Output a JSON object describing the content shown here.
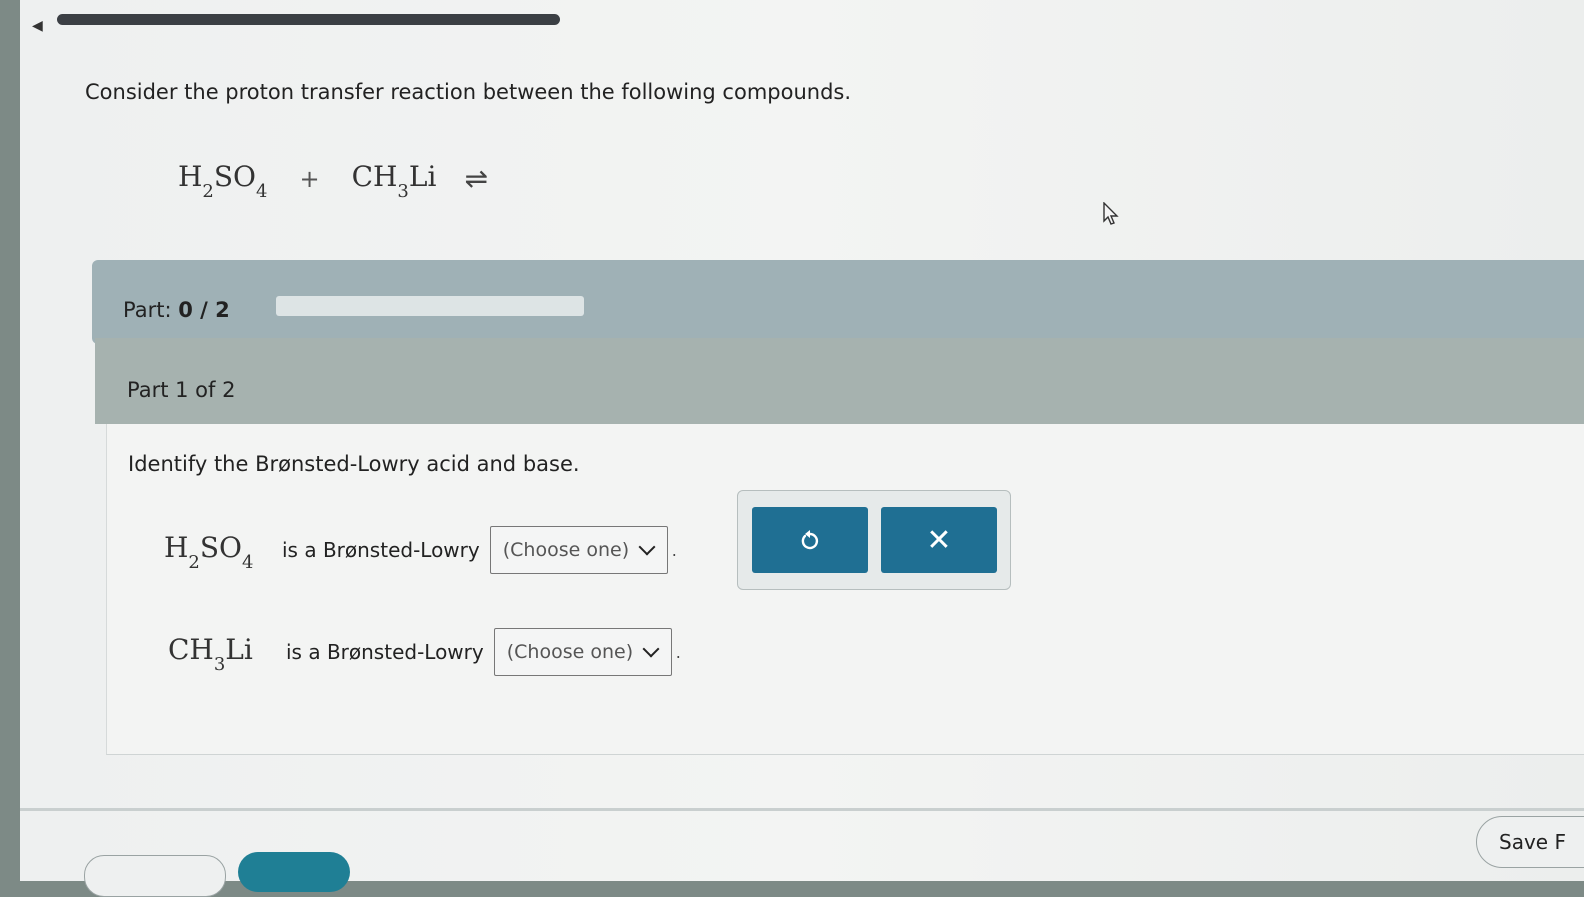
{
  "nav": {
    "back_arrow": "◀"
  },
  "prompt": "Consider the proton transfer reaction between the following compounds.",
  "equation": {
    "reactant1": {
      "base": "H",
      "sub1": "2",
      "mid": "SO",
      "sub2": "4"
    },
    "plus": "+",
    "reactant2": {
      "base": "CH",
      "sub1": "3",
      "mid": "Li"
    },
    "arrow": "⇌"
  },
  "part_progress": {
    "label": "Part:",
    "value": "0 / 2",
    "fraction": 0
  },
  "part_header": "Part 1 of 2",
  "question": "Identify the Brønsted-Lowry acid and base.",
  "rows": [
    {
      "compound": {
        "base": "H",
        "sub1": "2",
        "mid": "SO",
        "sub2": "4"
      },
      "text": "is a Brønsted-Lowry",
      "select": "(Choose one)",
      "period": "."
    },
    {
      "compound": {
        "base": "CH",
        "sub1": "3",
        "mid": "Li"
      },
      "text": "is a Brønsted-Lowry",
      "select": "(Choose one)",
      "period": "."
    }
  ],
  "buttons": {
    "undo_icon": "undo-icon",
    "clear_label": "✕"
  },
  "footer": {
    "save_label": "Save F"
  },
  "colors": {
    "accent": "#1f6f93",
    "part_bar": "#9fb1b6",
    "part_header": "#a6b2af"
  }
}
